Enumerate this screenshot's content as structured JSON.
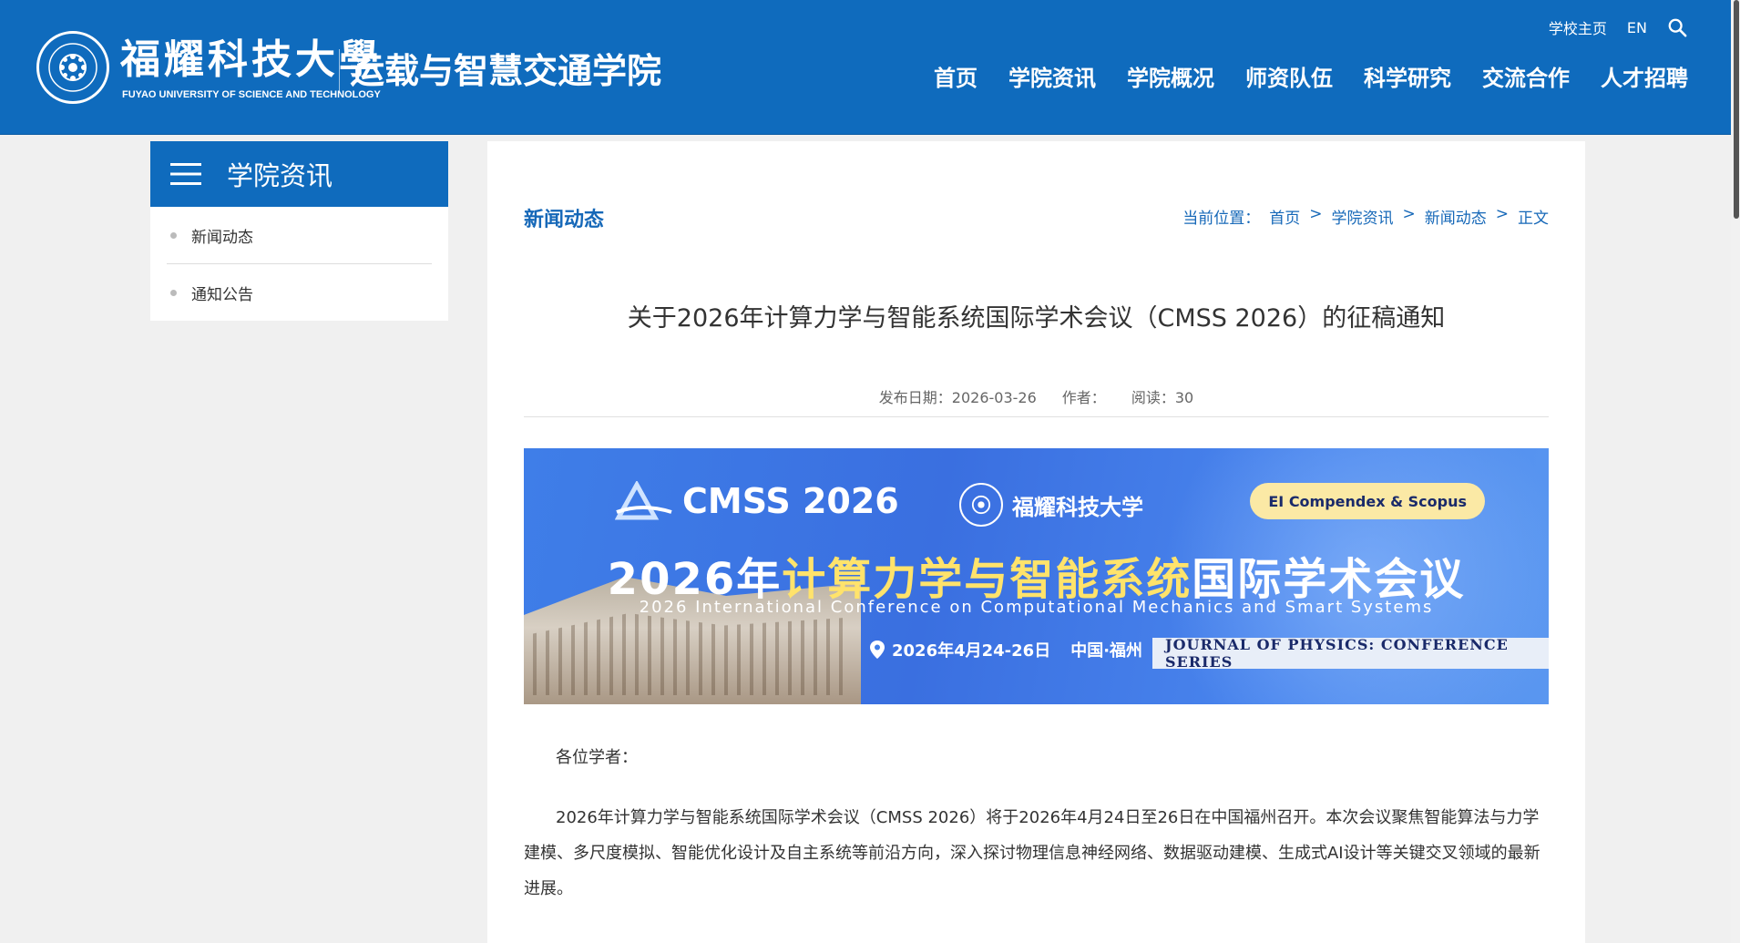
{
  "header": {
    "logo_cn": "福耀科技大學",
    "logo_en": "FUYAO UNIVERSITY OF SCIENCE AND TECHNOLOGY",
    "college_name": "运载与智慧交通学院",
    "top_links": {
      "home": "学校主页",
      "lang": "EN"
    },
    "nav": [
      "首页",
      "学院资讯",
      "学院概况",
      "师资队伍",
      "科学研究",
      "交流合作",
      "人才招聘"
    ]
  },
  "sidebar": {
    "title": "学院资讯",
    "items": [
      "新闻动态",
      "通知公告"
    ]
  },
  "content": {
    "section_title": "新闻动态",
    "breadcrumb": {
      "prefix": "当前位置：",
      "items": [
        "首页",
        "学院资讯",
        "新闻动态",
        "正文"
      ],
      "sep": ">"
    },
    "article_title": "关于2026年计算力学与智能系统国际学术会议（CMSS 2026）的征稿通知",
    "meta": {
      "date": "发布日期：2026-03-26",
      "author": "作者：",
      "reads": "阅读：30"
    },
    "banner": {
      "cmss": "CMSS 2026",
      "univ": "福耀科技大学",
      "badge": "EI Compendex & Scopus",
      "title_a": "2026年",
      "title_b": "计算力学与智能系统",
      "title_c": "国际学术会议",
      "title_en": "2026 International Conference on Computational Mechanics and Smart Systems",
      "date": "2026年4月24-26日",
      "location": "中国·福州",
      "journal": "JOURNAL OF PHYSICS: CONFERENCE SERIES"
    },
    "greeting": "各位学者：",
    "paragraph": "2026年计算力学与智能系统国际学术会议（CMSS 2026）将于2026年4月24日至26日在中国福州召开。本次会议聚焦智能算法与力学建模、多尺度模拟、智能优化设计及自主系统等前沿方向，深入探讨物理信息神经网络、数据驱动建模、生成式AI设计等关键交叉领域的最新进展。"
  },
  "colors": {
    "brand": "#0f6bbd",
    "link": "#1668b8",
    "background": "#f0f0f0"
  }
}
